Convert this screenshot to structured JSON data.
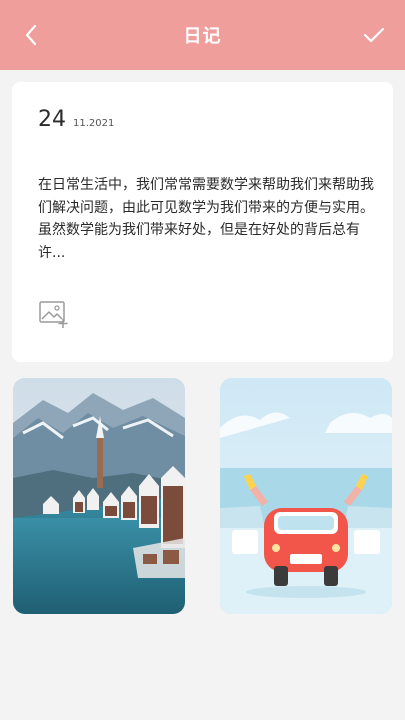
{
  "header": {
    "title": "日记"
  },
  "entry": {
    "day": "24",
    "month_year": "11.2021",
    "content": "在日常生活中，我们常常需要数学来帮助我们来帮助我们解决问题，由此可见数学为我们带来的方便与实用。虽然数学能为我们带来好处，但是在好处的背后总有许..."
  },
  "icons": {
    "back": "chevron-left-icon",
    "confirm": "check-icon",
    "add_image": "image-add-icon"
  },
  "colors": {
    "header_bg": "#ef9e9c",
    "page_bg": "#f3f3f3"
  }
}
